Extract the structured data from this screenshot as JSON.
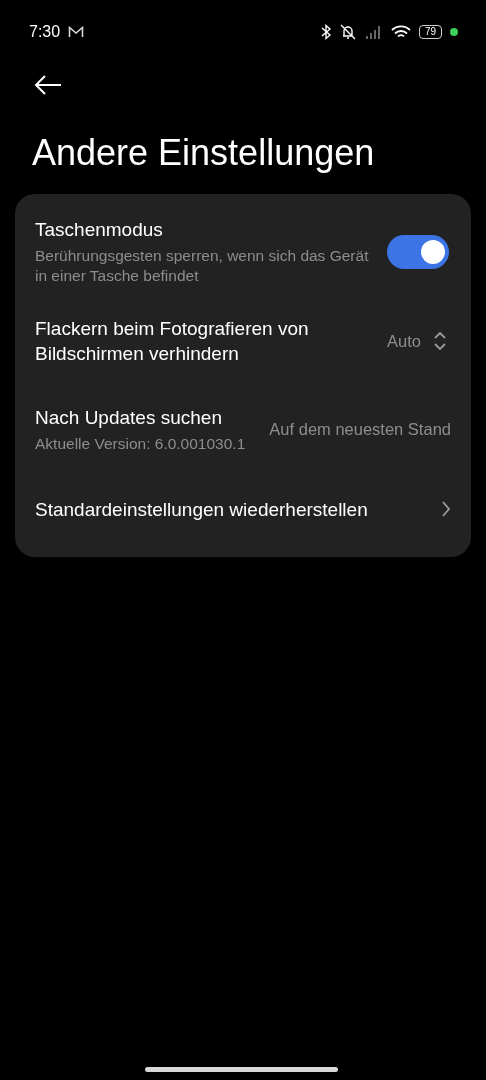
{
  "status_bar": {
    "time": "7:30",
    "battery": "79"
  },
  "title": "Andere Einstellungen",
  "items": [
    {
      "kind": "toggle",
      "title": "Taschenmodus",
      "subtitle": "Berührungsgesten sperren, wenn sich das Gerät in einer Tasche befindet",
      "on": true
    },
    {
      "kind": "select",
      "title": "Flackern beim Fotografieren von Bildschirmen verhindern",
      "value": "Auto"
    },
    {
      "kind": "value",
      "title": "Nach Updates suchen",
      "subtitle": "Aktuelle Version: 6.0.001030.1",
      "value": "Auf dem neuesten Stand"
    },
    {
      "kind": "link",
      "title": "Standardeinstellungen wiederherstellen"
    }
  ]
}
